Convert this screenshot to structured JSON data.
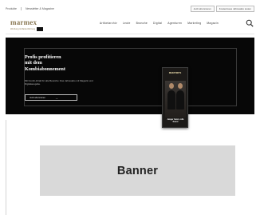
{
  "topbar": {
    "links": [
      "Produkte",
      "Newsletter & Magazine"
    ],
    "buttons": [
      "Jetzt abonnieren",
      "Kostenloses Jahresabo testen"
    ]
  },
  "header": {
    "logo": "marmex",
    "tagline": "Werbung & Markenführung",
    "nav": [
      "Artikelarchiv",
      "Leute",
      "Branche",
      "Digital",
      "Agenturen",
      "Marketing",
      "Magazin"
    ],
    "search_icon": "search-icon"
  },
  "hero": {
    "title_line1": "Profis profitieren",
    "title_line2": "mit dem",
    "title_line3": "Kombiabonnement",
    "subtitle": "Mit Kombi-Inhalt für alle Bereiche: Das Jahresabo mit Magazin und Digitalausgabe.",
    "button": "Jetzt abonnieren",
    "button_arrow": "→",
    "magazine_title": "marmex",
    "magazine_cover_line": "Junger Geist, reife Kunst"
  },
  "banner": {
    "label": "Banner"
  },
  "colors": {
    "brand_gold": "#8c7a56",
    "hero_bg": "#070707",
    "banner_bg": "#d9d9d9"
  }
}
